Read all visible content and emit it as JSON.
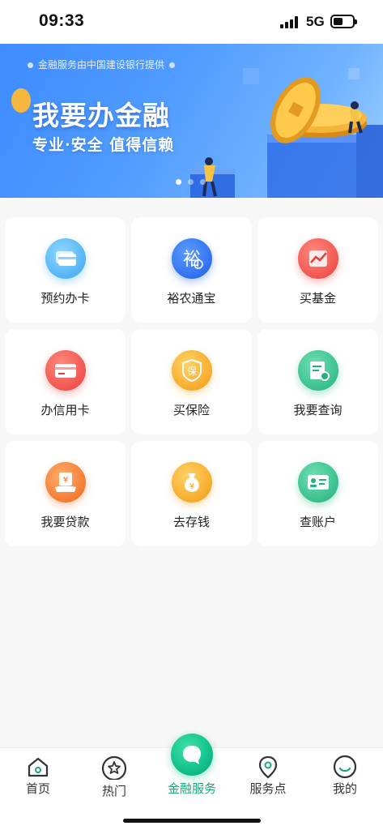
{
  "status_bar": {
    "time": "09:33",
    "network": "5G"
  },
  "banner": {
    "provider_text": "金融服务由中国建设银行提供",
    "title": "我要办金融",
    "subtitle": "专业·安全  值得信赖",
    "pagination": {
      "count": 3,
      "active": 0
    }
  },
  "services": [
    {
      "label": "预约办卡",
      "icon": "bank-card-icon",
      "color": "#4fb4f5"
    },
    {
      "label": "裕农通宝",
      "icon": "yunong-icon",
      "color": "#2b6ff2"
    },
    {
      "label": "买基金",
      "icon": "fund-chart-icon",
      "color": "#f2514a"
    },
    {
      "label": "办信用卡",
      "icon": "credit-card-icon",
      "color": "#f2514a"
    },
    {
      "label": "买保险",
      "icon": "insurance-shield-icon",
      "color": "#f5a623"
    },
    {
      "label": "我要查询",
      "icon": "query-document-icon",
      "color": "#2fbf8a"
    },
    {
      "label": "我要贷款",
      "icon": "loan-icon",
      "color": "#f5782a"
    },
    {
      "label": "去存钱",
      "icon": "money-bag-icon",
      "color": "#f5a623"
    },
    {
      "label": "查账户",
      "icon": "account-id-icon",
      "color": "#2fbf8a"
    }
  ],
  "bottom_nav": {
    "items": [
      {
        "label": "首页",
        "icon": "home-icon"
      },
      {
        "label": "热门",
        "icon": "star-icon"
      },
      {
        "label": "金融服务",
        "icon": "chat-bubble-icon",
        "active": true
      },
      {
        "label": "服务点",
        "icon": "location-pin-icon"
      },
      {
        "label": "我的",
        "icon": "smile-icon"
      }
    ]
  },
  "colors": {
    "accent": "#12c08a",
    "banner": "#3d8bff",
    "background": "#f7f7f7"
  }
}
